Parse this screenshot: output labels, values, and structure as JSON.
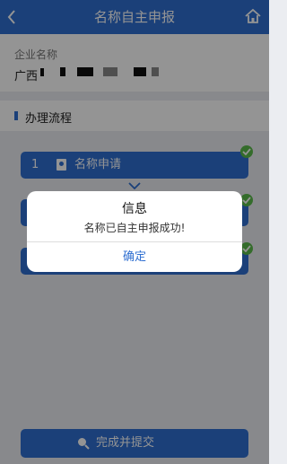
{
  "header": {
    "title": "名称自主申报"
  },
  "company": {
    "label": "企业名称",
    "name_prefix": "广西"
  },
  "section": {
    "title": "办理流程"
  },
  "steps": [
    {
      "number": "1",
      "label": "名称申请",
      "completed": true
    },
    {
      "number": "",
      "label": "",
      "completed": true
    },
    {
      "number": "",
      "label": "",
      "completed": true
    }
  ],
  "submit": {
    "label": "完成并提交"
  },
  "dialog": {
    "title": "信息",
    "message": "名称已自主申报成功!",
    "confirm_label": "确定"
  },
  "colors": {
    "primary": "#2f6fd1",
    "success": "#5bbb4a"
  }
}
